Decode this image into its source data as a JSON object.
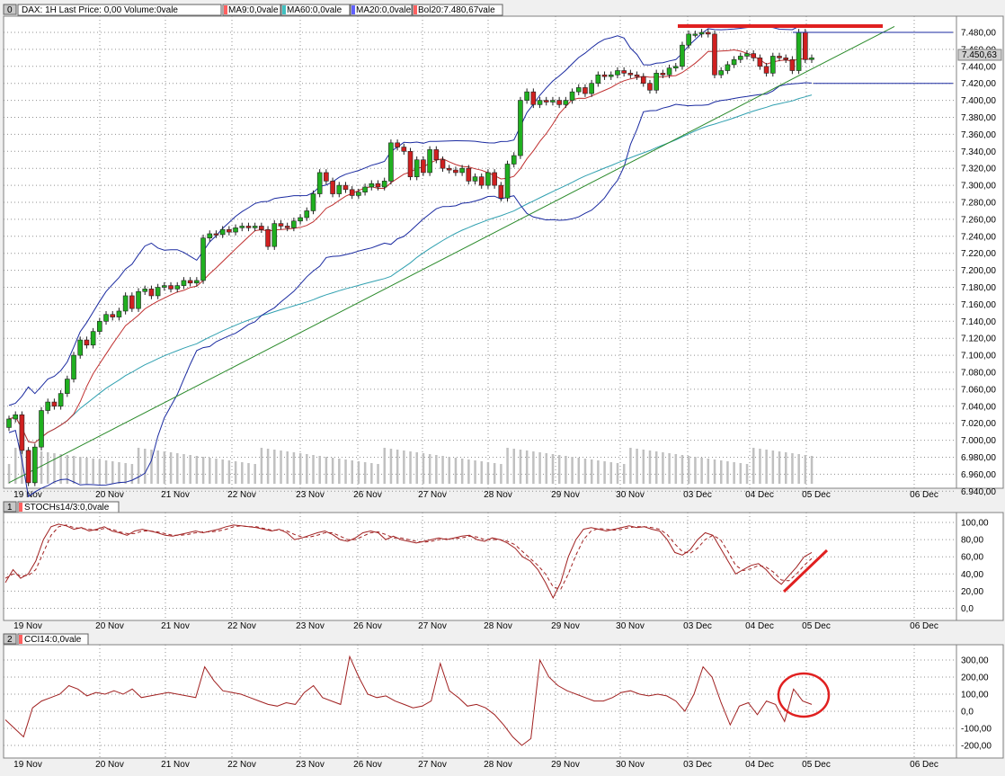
{
  "chart_data": [
    {
      "type": "candlestick",
      "panel": "price",
      "header": {
        "index": "0",
        "title": "DAX: 1H Last Price: 0,00 Volume:0vale",
        "indicators": [
          {
            "label": "MA9:0,0vale",
            "color": "#ff6060"
          },
          {
            "label": "MA60:0,0vale",
            "color": "#40c0c0"
          },
          {
            "label": "MA20:0,0vale",
            "color": "#6060ff"
          },
          {
            "label": "Bol20:7.480,67vale",
            "color": "#ff6060"
          }
        ]
      },
      "y_ticks": [
        "7.480,00",
        "7.460,00",
        "7.440,00",
        "7.420,00",
        "7.400,00",
        "7.380,00",
        "7.360,00",
        "7.340,00",
        "7.320,00",
        "7.300,00",
        "7.280,00",
        "7.260,00",
        "7.240,00",
        "7.220,00",
        "7.200,00",
        "7.180,00",
        "7.160,00",
        "7.140,00",
        "7.120,00",
        "7.100,00",
        "7.080,00",
        "7.060,00",
        "7.040,00",
        "7.020,00",
        "7.000,00",
        "6.980,00",
        "6.960,00",
        "6.940,00"
      ],
      "ylim": [
        6935,
        7490
      ],
      "last_price_label": "7.450,63",
      "x_labels": [
        "19 Nov",
        "20 Nov",
        "21 Nov",
        "22 Nov",
        "23 Nov",
        "26 Nov",
        "27 Nov",
        "28 Nov",
        "29 Nov",
        "30 Nov",
        "03 Dec",
        "04 Dec",
        "05 Dec",
        "06 Dec"
      ],
      "closes": [
        7025,
        7030,
        6988,
        6950,
        6992,
        7035,
        7045,
        7040,
        7055,
        7072,
        7100,
        7118,
        7112,
        7128,
        7140,
        7148,
        7145,
        7152,
        7170,
        7155,
        7175,
        7178,
        7170,
        7180,
        7182,
        7178,
        7182,
        7188,
        7185,
        7188,
        7238,
        7243,
        7242,
        7248,
        7245,
        7250,
        7252,
        7250,
        7252,
        7248,
        7228,
        7255,
        7252,
        7250,
        7258,
        7262,
        7270,
        7290,
        7315,
        7305,
        7290,
        7300,
        7295,
        7288,
        7292,
        7298,
        7302,
        7298,
        7305,
        7350,
        7345,
        7340,
        7310,
        7330,
        7315,
        7342,
        7330,
        7320,
        7318,
        7315,
        7320,
        7305,
        7310,
        7300,
        7315,
        7300,
        7285,
        7325,
        7335,
        7400,
        7410,
        7395,
        7400,
        7398,
        7400,
        7395,
        7400,
        7410,
        7415,
        7408,
        7420,
        7430,
        7428,
        7430,
        7435,
        7432,
        7430,
        7428,
        7420,
        7412,
        7432,
        7430,
        7438,
        7440,
        7465,
        7478,
        7478,
        7480,
        7478,
        7430,
        7435,
        7442,
        7448,
        7452,
        7455,
        7450,
        7440,
        7432,
        7452,
        7450,
        7448,
        7435,
        7480,
        7448,
        7450
      ],
      "ma_lines": [
        {
          "name": "MA9",
          "color": "#c03030"
        },
        {
          "name": "MA20",
          "color": "#2020c0"
        },
        {
          "name": "MA60",
          "color": "#30a0b0"
        }
      ],
      "bollinger": {
        "upper_start": 6990,
        "band_color": "#1a2aa0"
      },
      "trendline": {
        "from": [
          0,
          6950
        ],
        "to": [
          126,
          7487
        ],
        "color": "#2a8a2a"
      },
      "annotations": {
        "resistance": 7486,
        "resistance_color": "#e02020",
        "horizontal_levels": [
          7480,
          7420
        ]
      }
    },
    {
      "type": "line",
      "panel": "stochastic",
      "header": {
        "index": "1",
        "label": "STOCHs14/3:0,0vale",
        "color": "#ff6060"
      },
      "y_ticks": [
        "100,00",
        "80,00",
        "60,00",
        "40,00",
        "20,00",
        "0,0"
      ],
      "ylim": [
        -5,
        105
      ],
      "x_labels": [
        "19 Nov",
        "20 Nov",
        "21 Nov",
        "22 Nov",
        "23 Nov",
        "26 Nov",
        "27 Nov",
        "28 Nov",
        "29 Nov",
        "30 Nov",
        "03 Dec",
        "04 Dec",
        "05 Dec",
        "06 Dec"
      ],
      "series": [
        {
          "name": "%K",
          "color": "#a02020",
          "values": [
            30,
            45,
            35,
            40,
            55,
            80,
            95,
            98,
            96,
            92,
            94,
            90,
            92,
            95,
            90,
            88,
            85,
            90,
            92,
            90,
            88,
            85,
            84,
            86,
            88,
            90,
            88,
            90,
            92,
            95,
            97,
            96,
            95,
            94,
            92,
            90,
            92,
            88,
            80,
            82,
            85,
            88,
            90,
            86,
            80,
            78,
            82,
            88,
            90,
            88,
            80,
            84,
            80,
            78,
            76,
            78,
            80,
            82,
            80,
            82,
            84,
            85,
            80,
            78,
            82,
            80,
            76,
            70,
            60,
            55,
            45,
            30,
            12,
            30,
            60,
            80,
            92,
            94,
            92,
            90,
            92,
            94,
            96,
            94,
            95,
            92,
            90,
            80,
            65,
            62,
            68,
            80,
            88,
            85,
            70,
            55,
            40,
            45,
            50,
            52,
            45,
            35,
            28,
            38,
            48,
            60,
            65
          ]
        },
        {
          "name": "%D",
          "color": "#a02020",
          "dashed": true,
          "values": [
            35,
            40,
            38,
            38,
            45,
            65,
            85,
            95,
            97,
            94,
            93,
            92,
            91,
            93,
            92,
            89,
            87,
            87,
            90,
            90,
            89,
            87,
            85,
            85,
            86,
            88,
            89,
            89,
            90,
            92,
            95,
            96,
            95,
            95,
            93,
            91,
            91,
            90,
            86,
            83,
            83,
            85,
            88,
            88,
            84,
            80,
            80,
            84,
            88,
            89,
            86,
            82,
            82,
            80,
            78,
            77,
            78,
            80,
            81,
            81,
            82,
            84,
            83,
            80,
            80,
            80,
            78,
            74,
            66,
            58,
            50,
            40,
            25,
            22,
            40,
            62,
            80,
            90,
            93,
            92,
            91,
            92,
            94,
            95,
            95,
            94,
            92,
            86,
            75,
            66,
            64,
            70,
            80,
            85,
            80,
            66,
            50,
            44,
            46,
            50,
            48,
            42,
            33,
            32,
            40,
            50,
            58
          ]
        }
      ],
      "annotation": {
        "color": "#e02020"
      }
    },
    {
      "type": "line",
      "panel": "cci",
      "header": {
        "index": "2",
        "label": "CCI14:0,0vale",
        "color": "#ff6060"
      },
      "y_ticks": [
        "300,00",
        "200,00",
        "100,00",
        "0,0",
        "-100,00",
        "-200,00"
      ],
      "ylim": [
        -250,
        350
      ],
      "x_labels": [
        "19 Nov",
        "20 Nov",
        "21 Nov",
        "22 Nov",
        "23 Nov",
        "26 Nov",
        "27 Nov",
        "28 Nov",
        "29 Nov",
        "30 Nov",
        "03 Dec",
        "04 Dec",
        "05 Dec",
        "06 Dec"
      ],
      "series": [
        {
          "name": "CCI",
          "color": "#a02020",
          "values": [
            -50,
            -100,
            -150,
            20,
            60,
            80,
            100,
            150,
            130,
            90,
            110,
            100,
            120,
            100,
            130,
            80,
            90,
            100,
            110,
            100,
            90,
            80,
            260,
            180,
            120,
            110,
            100,
            80,
            60,
            40,
            30,
            50,
            40,
            110,
            150,
            80,
            60,
            40,
            320,
            200,
            100,
            80,
            90,
            60,
            40,
            20,
            30,
            60,
            280,
            120,
            80,
            30,
            40,
            20,
            -20,
            -80,
            -150,
            -200,
            -160,
            300,
            200,
            150,
            120,
            100,
            80,
            60,
            60,
            80,
            110,
            120,
            100,
            90,
            100,
            90,
            60,
            0,
            100,
            260,
            200,
            50,
            -80,
            30,
            50,
            -20,
            60,
            40,
            -60,
            130,
            60,
            40
          ]
        }
      ],
      "annotation": {
        "color": "#e02020"
      }
    }
  ]
}
